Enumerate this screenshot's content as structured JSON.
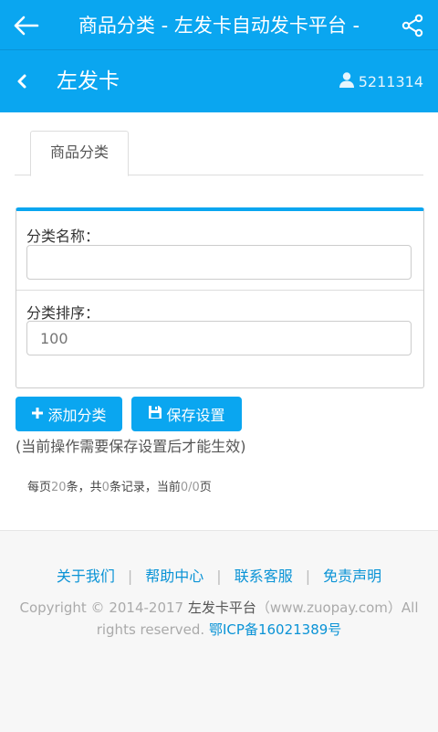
{
  "appbar": {
    "title": "商品分类 - 左发卡自动发卡平台 -"
  },
  "subbar": {
    "name": "左发卡",
    "user": "5211314"
  },
  "tabs": [
    {
      "label": "商品分类"
    }
  ],
  "form": {
    "name_label": "分类名称：",
    "name_value": "",
    "order_label": "分类排序：",
    "order_placeholder": "100"
  },
  "buttons": {
    "add": "添加分类",
    "save": "保存设置"
  },
  "note": "(当前操作需要保存设置后才能生效)",
  "pager": {
    "t1": "每页",
    "per_page": "20",
    "t2": "条，共",
    "total": "0",
    "t3": "条记录，当前",
    "current": "0/0",
    "t4": "页"
  },
  "footer": {
    "links": [
      "关于我们",
      "帮助中心",
      "联系客服",
      "免责声明"
    ],
    "copyright_a": "Copyright © 2014-2017 ",
    "brand": "左发卡平台",
    "copyright_b": "（www.zuopay.com）All rights reserved. ",
    "icp_prefix": "鄂",
    "icp": "ICP备16021389号"
  },
  "colors": {
    "accent": "#0aa6f0",
    "link": "#0a93d6"
  }
}
